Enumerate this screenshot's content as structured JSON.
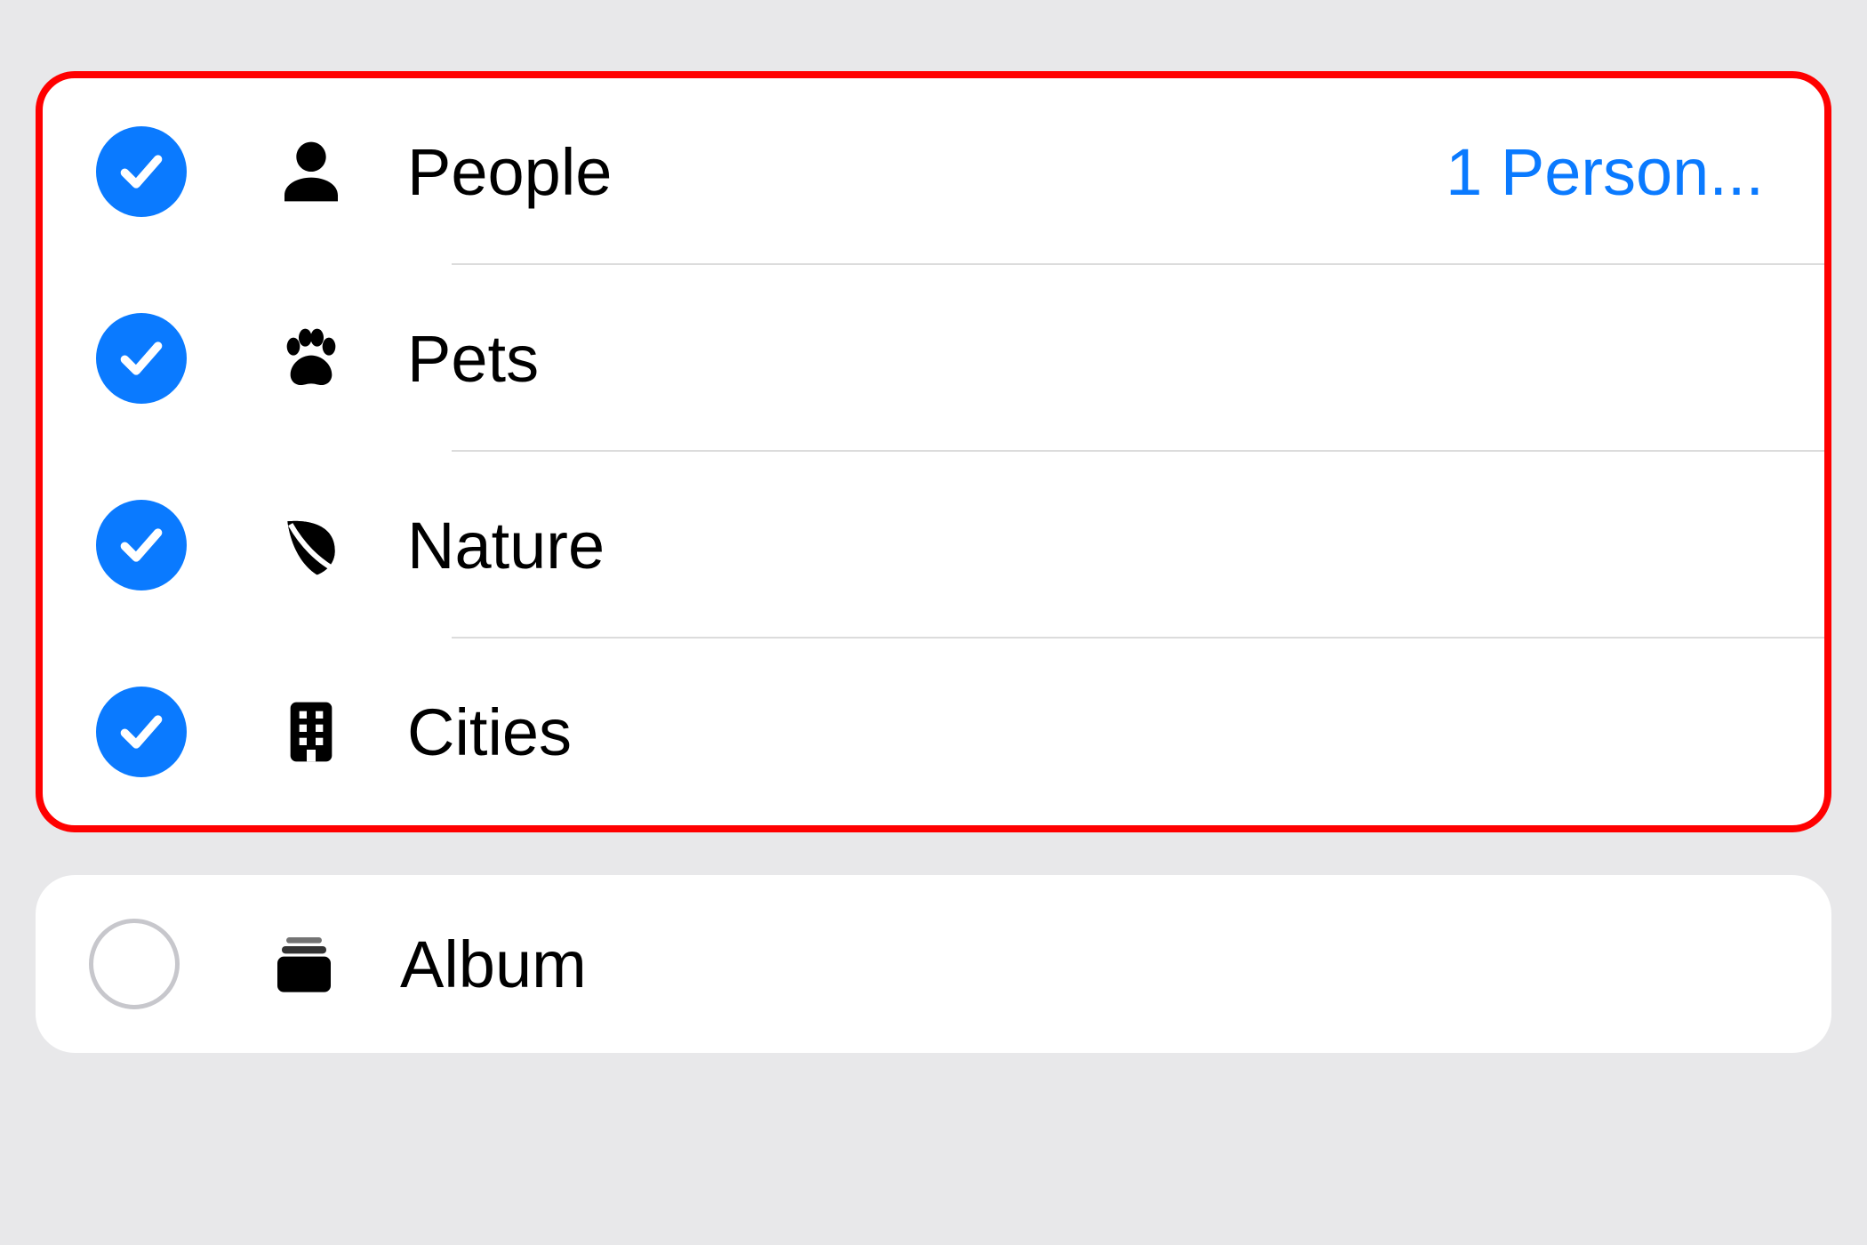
{
  "colors": {
    "accent": "#0a7aff",
    "highlight_border": "#ff0000",
    "background": "#e8e8ea"
  },
  "groups": [
    {
      "highlighted": true,
      "items": [
        {
          "label": "People",
          "icon": "person-icon",
          "checked": true,
          "trailing": "1 Person..."
        },
        {
          "label": "Pets",
          "icon": "paw-icon",
          "checked": true,
          "trailing": ""
        },
        {
          "label": "Nature",
          "icon": "leaf-icon",
          "checked": true,
          "trailing": ""
        },
        {
          "label": "Cities",
          "icon": "building-icon",
          "checked": true,
          "trailing": ""
        }
      ]
    },
    {
      "highlighted": false,
      "items": [
        {
          "label": "Album",
          "icon": "album-icon",
          "checked": false,
          "trailing": ""
        }
      ]
    }
  ]
}
